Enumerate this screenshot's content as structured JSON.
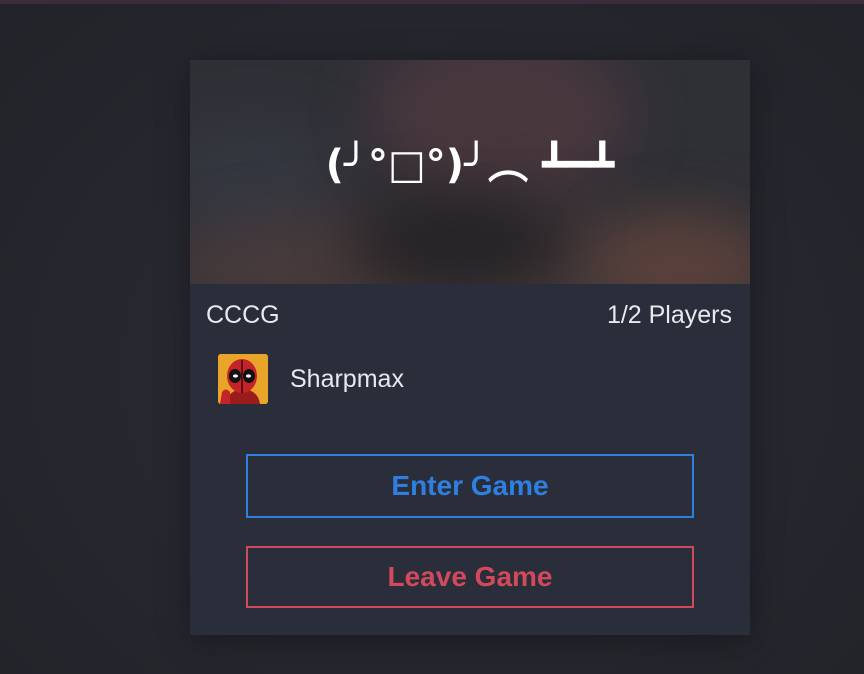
{
  "lobby_card": {
    "banner_text": "(╯°□°)╯︵ ┻━┻",
    "game_name": "CCCG",
    "players_count": "1/2 Players",
    "players": [
      {
        "name": "Sharpmax",
        "avatar_icon": "deadpool-avatar-icon"
      }
    ],
    "enter_button_label": "Enter Game",
    "leave_button_label": "Leave Game"
  },
  "colors": {
    "background": "#26262e",
    "card": "#2a2e3b",
    "enter_accent": "#2f7fe0",
    "leave_accent": "#d14a5c",
    "text": "#e8e9ee",
    "avatar_bg": "#e8a52a"
  }
}
